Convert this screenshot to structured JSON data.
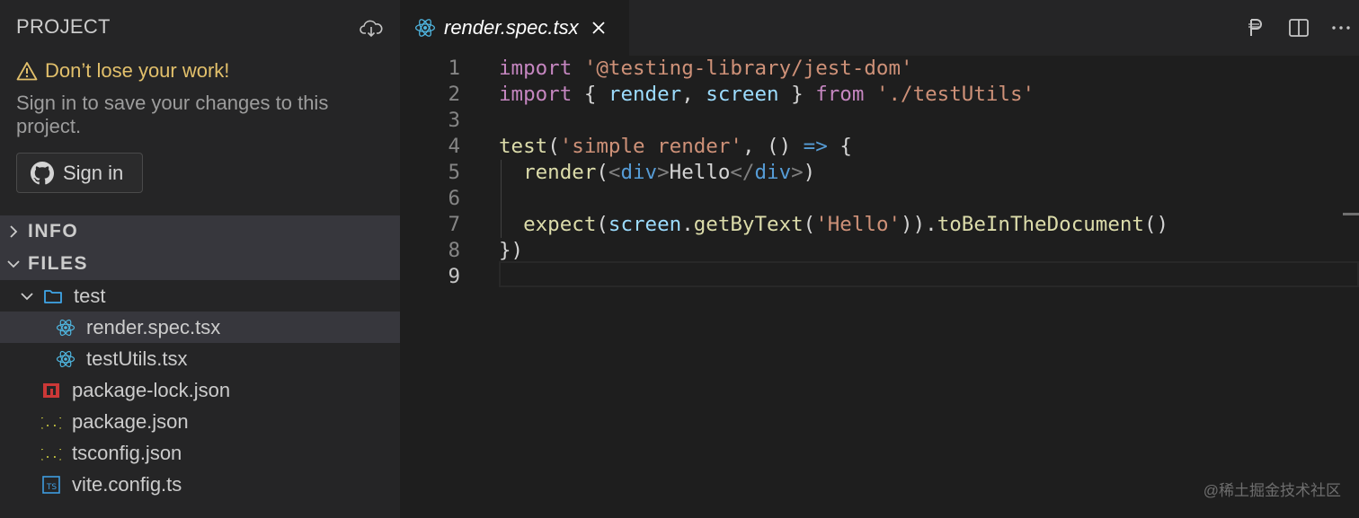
{
  "sidebar": {
    "title": "PROJECT",
    "warning_title": "Don’t lose your work!",
    "warning_text": "Sign in to save your changes to this project.",
    "signin_label": "Sign in",
    "sections": {
      "info": "INFO",
      "files": "FILES"
    },
    "tree": [
      {
        "name": "test",
        "icon": "folder-icon",
        "expanded": true
      },
      {
        "name": "render.spec.tsx",
        "icon": "react-icon",
        "selected": true
      },
      {
        "name": "testUtils.tsx",
        "icon": "react-icon"
      },
      {
        "name": "package-lock.json",
        "icon": "npm-icon"
      },
      {
        "name": "package.json",
        "icon": "json-icon"
      },
      {
        "name": "tsconfig.json",
        "icon": "json-icon"
      },
      {
        "name": "vite.config.ts",
        "icon": "typescript-icon"
      }
    ]
  },
  "editor": {
    "tab_title": "render.spec.tsx",
    "active_line": "9",
    "line_numbers": [
      "1",
      "2",
      "3",
      "4",
      "5",
      "6",
      "7",
      "8",
      "9"
    ],
    "lines": [
      "import '@testing-library/jest-dom'",
      "import { render, screen } from './testUtils'",
      "",
      "test('simple render', () => {",
      "  render(<div>Hello</div>)",
      "",
      "  expect(screen.getByText('Hello')).toBeInTheDocument()",
      "})",
      ""
    ]
  },
  "watermark": "@稀土掘金技术社区",
  "colors": {
    "sidebar_bg": "#252526",
    "editor_bg": "#1e1e1e",
    "warning": "#e2c06b",
    "keyword": "#c586c0",
    "string": "#ce9178",
    "variable": "#9cdcfe",
    "function": "#dcdcaa"
  }
}
